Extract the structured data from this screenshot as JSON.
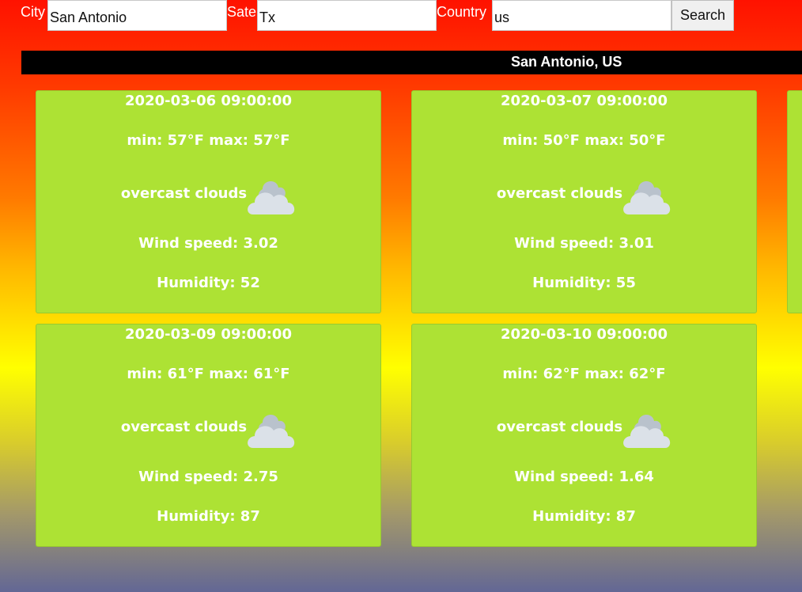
{
  "search": {
    "city_label": "City",
    "city_value": "San Antonio",
    "state_label": "Sate",
    "state_value": "Tx",
    "country_label": "Country",
    "country_value": "us",
    "button_label": "Search"
  },
  "location": {
    "title": "San Antonio, US"
  },
  "colors": {
    "card_background": "#ade234",
    "header_bar": "#000000",
    "text": "#ffffff"
  },
  "forecasts": [
    {
      "date": "2020-03-06 09:00:00",
      "minmax": "min: 57°F max: 57°F",
      "description": "overcast clouds",
      "icon": "cloud-icon",
      "wind": "Wind speed: 3.02",
      "humidity": "Humidity: 52"
    },
    {
      "date": "2020-03-07 09:00:00",
      "minmax": "min: 50°F max: 50°F",
      "description": "overcast clouds",
      "icon": "cloud-icon",
      "wind": "Wind speed: 3.01",
      "humidity": "Humidity: 55"
    },
    {
      "date": "2020-03-09 09:00:00",
      "minmax": "min: 61°F max: 61°F",
      "description": "overcast clouds",
      "icon": "cloud-icon",
      "wind": "Wind speed: 2.75",
      "humidity": "Humidity: 87"
    },
    {
      "date": "2020-03-10 09:00:00",
      "minmax": "min: 62°F max: 62°F",
      "description": "overcast clouds",
      "icon": "cloud-icon",
      "wind": "Wind speed: 1.64",
      "humidity": "Humidity: 87"
    }
  ]
}
